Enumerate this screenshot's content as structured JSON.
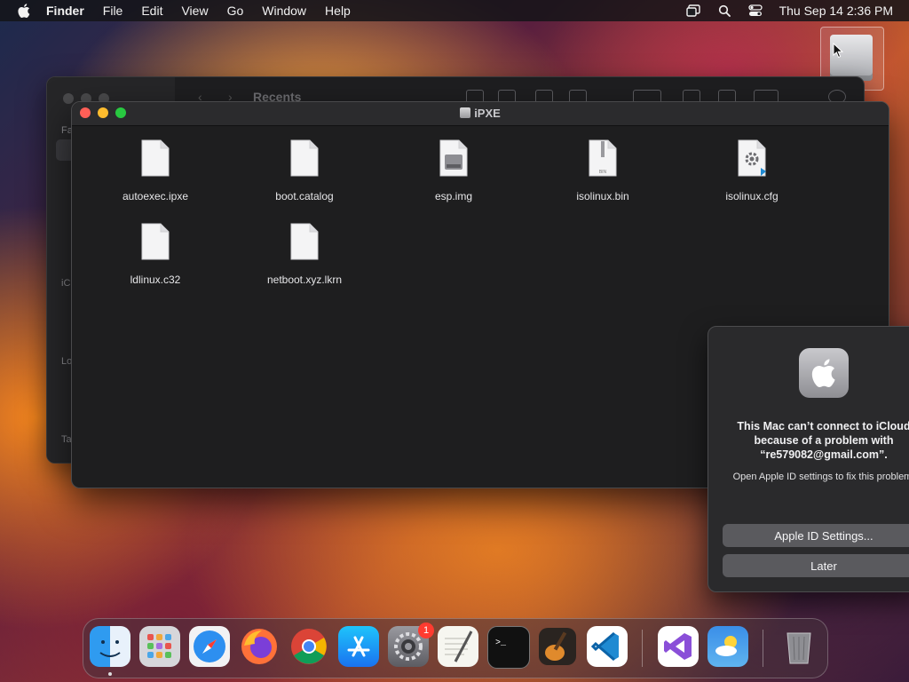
{
  "menubar": {
    "app_name": "Finder",
    "items": [
      "File",
      "Edit",
      "View",
      "Go",
      "Window",
      "Help"
    ],
    "clock": "Thu Sep 14  2:36 PM",
    "status_icons": [
      "screen-mirroring-icon",
      "spotlight-search-icon",
      "control-center-icon"
    ]
  },
  "back_window": {
    "title": "Recents",
    "sidebar_labels": [
      "Fa",
      "iC",
      "Lo",
      "Ta"
    ]
  },
  "front_window": {
    "title": "iPXE",
    "files": [
      {
        "name": "autoexec.ipxe",
        "icon": "document-icon"
      },
      {
        "name": "boot.catalog",
        "icon": "document-icon"
      },
      {
        "name": "esp.img",
        "icon": "disk-image-icon"
      },
      {
        "name": "isolinux.bin",
        "icon": "binary-file-icon",
        "tag": "BIN"
      },
      {
        "name": "isolinux.cfg",
        "icon": "config-file-icon"
      },
      {
        "name": "ldlinux.c32",
        "icon": "document-icon"
      },
      {
        "name": "netboot.xyz.lkrn",
        "icon": "document-icon"
      }
    ]
  },
  "alert": {
    "title": "This Mac can’t connect to iCloud because of a problem with “re579082@gmail.com”.",
    "message": "Open Apple ID settings to fix this problem.",
    "primary_button": "Apple ID Settings...",
    "secondary_button": "Later"
  },
  "dock": {
    "apps": [
      {
        "name": "Finder",
        "icon": "finder-icon",
        "running": true
      },
      {
        "name": "Launchpad",
        "icon": "launchpad-icon"
      },
      {
        "name": "Safari",
        "icon": "safari-icon"
      },
      {
        "name": "Firefox",
        "icon": "firefox-icon"
      },
      {
        "name": "Chrome",
        "icon": "chrome-icon"
      },
      {
        "name": "App Store",
        "icon": "app-store-icon"
      },
      {
        "name": "System Settings",
        "icon": "system-settings-icon",
        "badge": "1"
      },
      {
        "name": "TextEdit",
        "icon": "textedit-icon"
      },
      {
        "name": "Terminal",
        "icon": "terminal-icon"
      },
      {
        "name": "GarageBand",
        "icon": "garageband-icon"
      },
      {
        "name": "Visual Studio Code",
        "icon": "vscode-icon"
      },
      {
        "name": "Visual Studio",
        "icon": "visual-studio-icon"
      },
      {
        "name": "Weather",
        "icon": "weather-icon"
      },
      {
        "name": "Trash",
        "icon": "trash-icon"
      }
    ]
  },
  "colors": {
    "close": "#ff5f57",
    "minimize": "#febc2e",
    "maximize": "#28c840",
    "badge": "#ff3b30"
  }
}
